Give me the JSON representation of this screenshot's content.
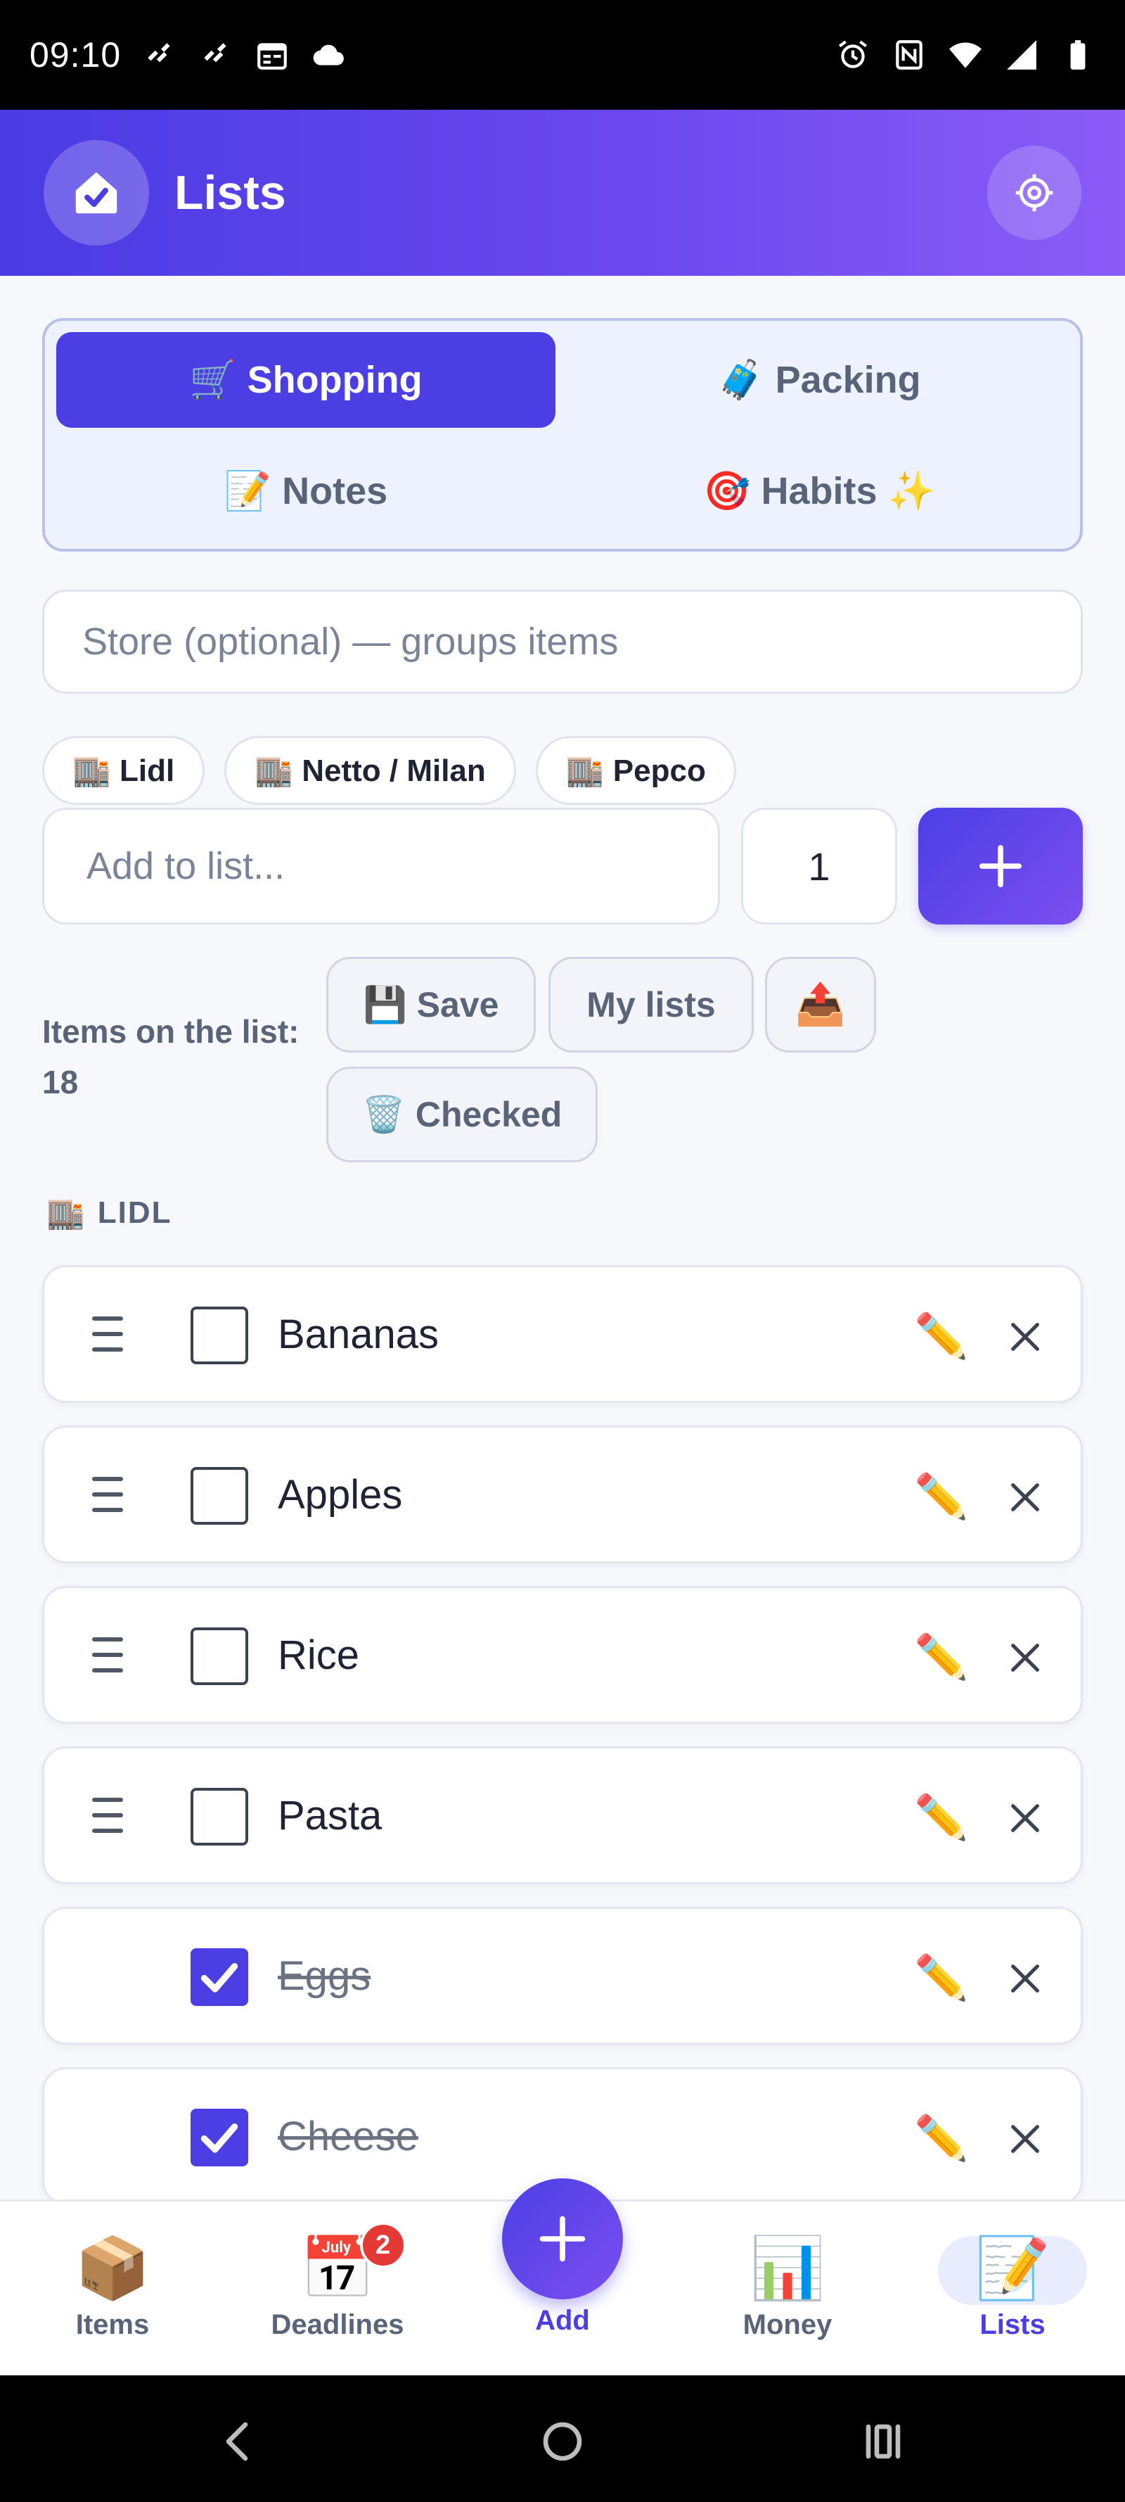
{
  "status_bar": {
    "time": "09:10"
  },
  "header": {
    "title": "Lists"
  },
  "list_types": [
    {
      "label": "🛒 Shopping",
      "active": true
    },
    {
      "label": "🧳 Packing",
      "active": false
    },
    {
      "label": "📝 Notes",
      "active": false
    },
    {
      "label": "🎯 Habits ✨",
      "active": false
    }
  ],
  "store_input": {
    "placeholder": "Store (optional) — groups items"
  },
  "store_chips": [
    "🏬 Lidl",
    "🏬 Netto / Milan",
    "🏬 Pepco"
  ],
  "add_row": {
    "placeholder": "Add to list...",
    "quantity": "1"
  },
  "summary": {
    "label": "Items on the list:",
    "count": "18"
  },
  "actions": {
    "save": "💾 Save",
    "my_lists": "My lists",
    "export": "📤",
    "clear_checked": "🗑️ Checked"
  },
  "group": {
    "icon": "🏬",
    "name": "LIDL"
  },
  "items": [
    {
      "name": "Bananas",
      "checked": false
    },
    {
      "name": "Apples",
      "checked": false
    },
    {
      "name": "Rice",
      "checked": false
    },
    {
      "name": "Pasta",
      "checked": false
    },
    {
      "name": "Eggs",
      "checked": true
    },
    {
      "name": "Cheese",
      "checked": true
    }
  ],
  "item_edit_icon": "✏️",
  "bottom_nav": {
    "items": [
      {
        "icon": "📦",
        "label": "Items"
      },
      {
        "icon": "📅",
        "label": "Deadlines",
        "badge": "2"
      },
      {
        "icon": "📊",
        "label": "Money"
      },
      {
        "icon": "📝",
        "label": "Lists"
      }
    ],
    "add_label": "Add",
    "active": "Lists"
  },
  "colors": {
    "accent": "#4b3fe4",
    "header_gradient_start": "#4a3be3",
    "header_gradient_end": "#8b5cf6",
    "badge": "#e53935"
  }
}
